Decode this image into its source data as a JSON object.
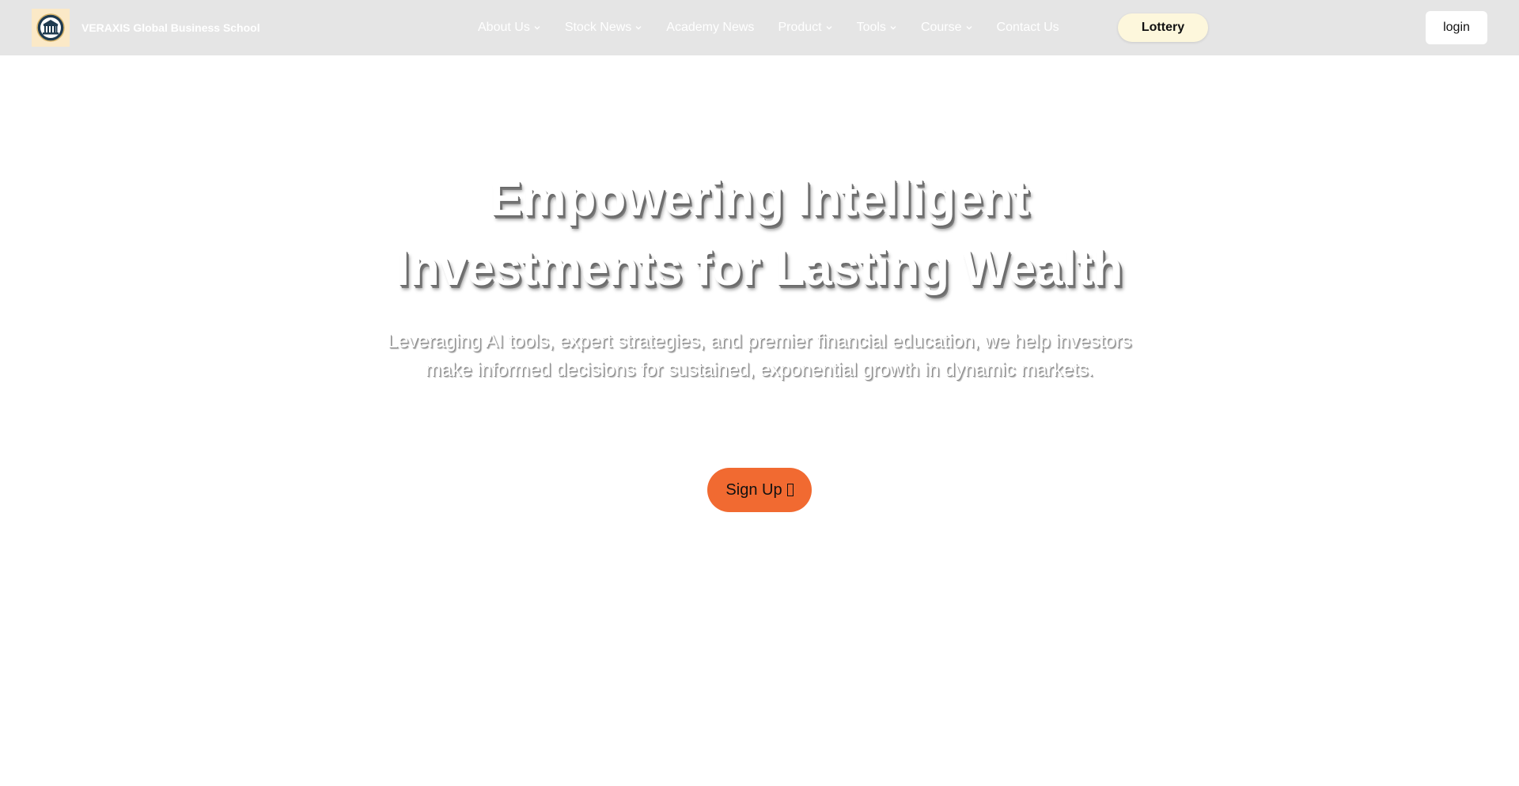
{
  "header": {
    "brand_name": "VERAXIS Global Business School",
    "logo_icon": "institution-building-icon",
    "nav_items": [
      {
        "label": "About Us",
        "has_dropdown": true
      },
      {
        "label": "Stock News",
        "has_dropdown": true
      },
      {
        "label": "Academy News",
        "has_dropdown": false
      },
      {
        "label": "Product",
        "has_dropdown": true
      },
      {
        "label": "Tools",
        "has_dropdown": true
      },
      {
        "label": "Course",
        "has_dropdown": true
      },
      {
        "label": "Contact Us",
        "has_dropdown": false
      }
    ],
    "lottery_label": "Lottery",
    "login_label": "login"
  },
  "hero": {
    "title_line1": "Empowering Intelligent",
    "title_line2": "Investments for Lasting Wealth",
    "subtitle_line1": "Leveraging AI tools, expert strategies, and premier financial education, we help investors",
    "subtitle_line2": "make informed decisions for sustained, exponential growth in dynamic markets.",
    "signup_label": "Sign Up",
    "signup_icon": "arrow-right-icon"
  },
  "colors": {
    "navbar_bg": "#e5e5e5",
    "logo_bg": "#fbe9c7",
    "lottery_bg": "#fdf7dc",
    "signup_bg": "#f16a31",
    "page_bg": "#ffffff"
  }
}
